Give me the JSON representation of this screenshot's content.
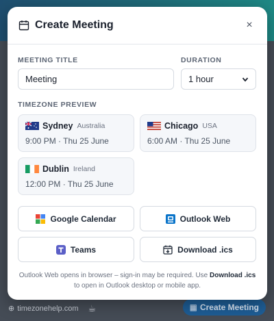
{
  "modal": {
    "title": "Create Meeting",
    "close_symbol": "×"
  },
  "form": {
    "title_label": "MEETING TITLE",
    "title_value": "Meeting",
    "duration_label": "DURATION",
    "duration_value": "1 hour",
    "timezone_label": "TIMEZONE PREVIEW"
  },
  "timezones": [
    {
      "city": "Sydney",
      "country": "Australia",
      "time": "9:00 PM · Thu 25 June",
      "flag": "au"
    },
    {
      "city": "Chicago",
      "country": "USA",
      "time": "6:00 AM · Thu 25 June",
      "flag": "us"
    },
    {
      "city": "Dublin",
      "country": "Ireland",
      "time": "12:00 PM · Thu 25 June",
      "flag": "ie"
    }
  ],
  "actions": {
    "google_calendar": "Google Calendar",
    "outlook_web": "Outlook Web",
    "teams": "Teams",
    "download_ics": "Download .ics"
  },
  "note": {
    "text_start": "Outlook Web opens in browser – sign-in may be required. Use ",
    "bold": "Download .ics",
    "text_end": " to open in Outlook desktop or mobile app."
  },
  "footer": {
    "site": "timezonehelp.com",
    "button_label": "Create Meeting"
  },
  "colors": {
    "accent": "#1e5d95",
    "header_gradient_start": "#1f4f70",
    "header_gradient_end": "#1e8a86"
  }
}
